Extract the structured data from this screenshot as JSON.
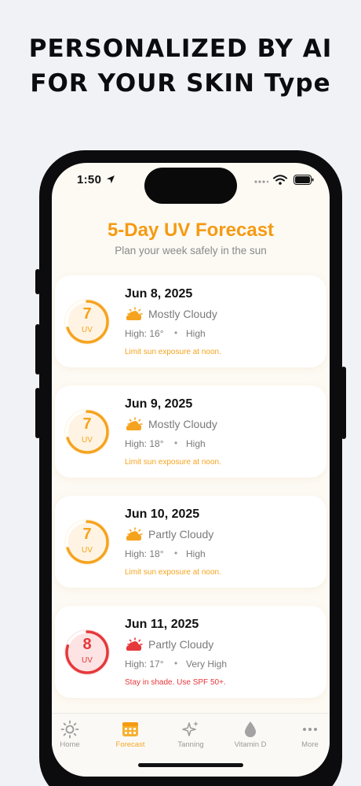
{
  "promo": {
    "line1": "PERSONALIZED BY AI",
    "line2": "FOR YOUR  SKIN Type"
  },
  "status_bar": {
    "time": "1:50",
    "icons": [
      "location-arrow-icon",
      "more-dots-icon",
      "wifi-icon",
      "battery-icon"
    ]
  },
  "screen": {
    "title": "5-Day UV Forecast",
    "subtitle": "Plan your week safely in the sun"
  },
  "forecast": [
    {
      "date": "Jun 8, 2025",
      "uv": "7",
      "uv_label": "UV",
      "condition": "Mostly Cloudy",
      "high": "High: 16°",
      "separator": "•",
      "level": "High",
      "advice": "Limit sun exposure at noon.",
      "accent": "#f5a31e",
      "ring_bg": "#fff4e3",
      "ring_fraction": 0.7,
      "icon": "cloud-sun-icon"
    },
    {
      "date": "Jun 9, 2025",
      "uv": "7",
      "uv_label": "UV",
      "condition": "Mostly Cloudy",
      "high": "High: 18°",
      "separator": "•",
      "level": "High",
      "advice": "Limit sun exposure at noon.",
      "accent": "#f5a31e",
      "ring_bg": "#fff4e3",
      "ring_fraction": 0.7,
      "icon": "cloud-sun-icon"
    },
    {
      "date": "Jun 10, 2025",
      "uv": "7",
      "uv_label": "UV",
      "condition": "Partly Cloudy",
      "high": "High: 18°",
      "separator": "•",
      "level": "High",
      "advice": "Limit sun exposure at noon.",
      "accent": "#f5a31e",
      "ring_bg": "#fff4e3",
      "ring_fraction": 0.7,
      "icon": "cloud-sun-icon"
    },
    {
      "date": "Jun 11, 2025",
      "uv": "8",
      "uv_label": "UV",
      "condition": "Partly Cloudy",
      "high": "High: 17°",
      "separator": "•",
      "level": "Very High",
      "advice": "Stay in shade. Use SPF 50+.",
      "accent": "#e5383b",
      "ring_bg": "#fde3e3",
      "ring_fraction": 0.8,
      "icon": "cloud-sun-icon"
    }
  ],
  "tabs": [
    {
      "label": "Home",
      "icon": "sun-icon",
      "active": false
    },
    {
      "label": "Forecast",
      "icon": "calendar-icon",
      "active": true
    },
    {
      "label": "Tanning",
      "icon": "sparkles-icon",
      "active": false
    },
    {
      "label": "Vitamin D",
      "icon": "drop-icon",
      "active": false
    },
    {
      "label": "More",
      "icon": "more-dots-icon",
      "active": false
    }
  ],
  "colors": {
    "accent": "#f59a12",
    "danger": "#e5383b",
    "background": "#fdfaf4"
  }
}
